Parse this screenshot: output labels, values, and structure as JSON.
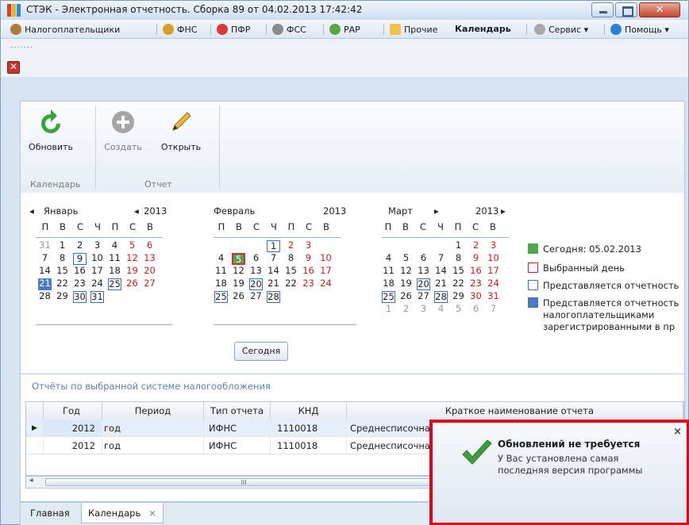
{
  "window": {
    "title": "СТЭК - Электронная отчетность. Сборка 89 от 04.02.2013 17:42:42"
  },
  "menu": [
    {
      "label": "Налогоплательщики",
      "icon": "people-icon"
    },
    {
      "label": "ФНС",
      "icon": "fns-icon"
    },
    {
      "label": "ПФР",
      "icon": "pfr-icon"
    },
    {
      "label": "ФСС",
      "icon": "fss-icon"
    },
    {
      "label": "РАР",
      "icon": "rar-icon"
    },
    {
      "label": "Прочие",
      "icon": "folder-icon"
    },
    {
      "label": "Календарь",
      "icon": ""
    },
    {
      "label": "Сервис ▾",
      "icon": "gear-icon"
    },
    {
      "label": "Помощь ▾",
      "icon": "help-icon"
    }
  ],
  "ribbon": {
    "refresh": "Обновить",
    "create": "Создать",
    "open": "Открыть",
    "group_calendar": "Календарь",
    "group_report": "Отчет"
  },
  "calendar": {
    "months": [
      {
        "name": "Январь",
        "year": "2013",
        "weekdays": [
          "П",
          "В",
          "С",
          "Ч",
          "П",
          "С",
          "В"
        ]
      },
      {
        "name": "Февраль",
        "year": "2013",
        "weekdays": [
          "П",
          "В",
          "С",
          "Ч",
          "П",
          "С",
          "В"
        ]
      },
      {
        "name": "Март",
        "year": "2013",
        "weekdays": [
          "П",
          "В",
          "С",
          "Ч",
          "П",
          "С",
          "В"
        ]
      }
    ],
    "prev_arrow": "◂",
    "next_arrow": "▸",
    "today_button": "Сегодня"
  },
  "legend": {
    "today": "Сегодня: 05.02.2013",
    "selected": "Выбранный день",
    "report_due": "Представляется отчетность",
    "report_due_registered": "Представляется отчетность налогоплательщиками зарегистрированными в пр"
  },
  "reports": {
    "title": "Отчёты по выбранной системе налогообложения",
    "columns": [
      "Год",
      "Период",
      "Тип отчета",
      "КНД",
      "Краткое наименование отчета"
    ],
    "rows": [
      {
        "year": "2012",
        "period": "год",
        "type": "ИФНС",
        "knd": "1110018",
        "name": "Среднесписочная численность"
      },
      {
        "year": "2012",
        "period": "год",
        "type": "ИФНС",
        "knd": "1110018",
        "name": "Среднесписочная численность"
      }
    ],
    "scroll_thumb": "III"
  },
  "tabs": [
    {
      "label": "Главная"
    },
    {
      "label": "Календарь"
    }
  ],
  "tab_close": "×",
  "popup": {
    "title": "Обновлений не требуется",
    "text": "У Вас установлена самая последняя версия программы",
    "close": "×"
  },
  "colors": {
    "today": "#4caa4c",
    "selected_border": "#cc2222",
    "report_border": "#3c6fb5",
    "report_fill": "#4b7cc8",
    "popup_highlight": "#e0001a"
  }
}
